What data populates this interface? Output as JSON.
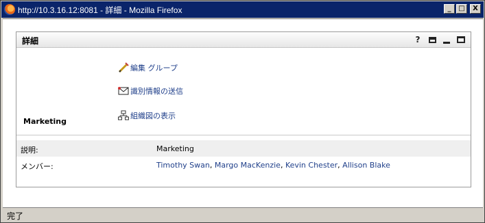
{
  "window": {
    "title": "http://10.3.16.12:8081 - 詳細 - Mozilla Firefox",
    "controls": {
      "minimize": "_",
      "maximize": "□",
      "close": "X"
    }
  },
  "portlet": {
    "title": "詳細",
    "tools": {
      "help": "?",
      "print_icon": "printer-icon",
      "minimize_icon": "minimize-icon",
      "maximize_icon": "maximize-icon"
    },
    "group_name": "Marketing",
    "actions": [
      {
        "label": "編集 グループ",
        "icon": "pencil-icon"
      },
      {
        "label": "識別情報の送信",
        "icon": "envelope-icon"
      },
      {
        "label": "組織図の表示",
        "icon": "org-chart-icon"
      }
    ],
    "details": {
      "description_label": "説明:",
      "description_value": "Marketing",
      "members_label": "メンバー:",
      "members": [
        "Timothy Swan",
        "Margo MacKenzie",
        "Kevin Chester",
        "Allison Blake"
      ],
      "members_separator": ", "
    }
  },
  "statusbar": {
    "text": "完了"
  }
}
